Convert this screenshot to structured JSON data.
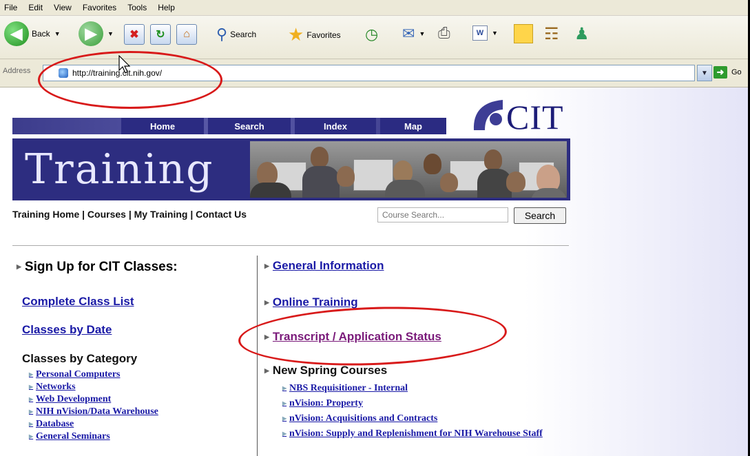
{
  "menu": [
    "File",
    "Edit",
    "View",
    "Favorites",
    "Tools",
    "Help"
  ],
  "toolbar": {
    "back_label": "Back",
    "search_label": "Search",
    "favorites_label": "Favorites"
  },
  "address": {
    "label": "Address",
    "url": "http://training.cit.nih.gov/",
    "go_label": "Go"
  },
  "site": {
    "logo_text": "CIT",
    "nav": [
      "Home",
      "Search",
      "Index",
      "Map"
    ],
    "banner_title": "Training",
    "link_bar": "Training Home | Courses | My Training | Contact Us",
    "search_placeholder": "Course Search...",
    "search_button": "Search"
  },
  "left": {
    "heading": "Sign Up for CIT Classes:",
    "links": [
      "Complete Class List",
      "Classes by Date"
    ],
    "category_title": "Classes by Category",
    "categories": [
      "Personal Computers",
      "Networks",
      "Web Development",
      "NIH nVision/Data Warehouse",
      "Database",
      "General Seminars"
    ]
  },
  "right": {
    "links": [
      "General Information",
      "Online Training",
      "Transcript / Application Status"
    ],
    "spring_title": "New Spring Courses",
    "spring_courses": [
      "NBS Requisitioner - Internal",
      "nVision: Property",
      "nVision: Acquisitions and Contracts",
      "nVision: Supply and Replenishment for NIH Warehouse Staff"
    ]
  },
  "colors": {
    "annotation": "#d81a1a",
    "link": "#1a1aa6",
    "visited_link": "#7a1a7a",
    "banner": "#2d2d80"
  }
}
